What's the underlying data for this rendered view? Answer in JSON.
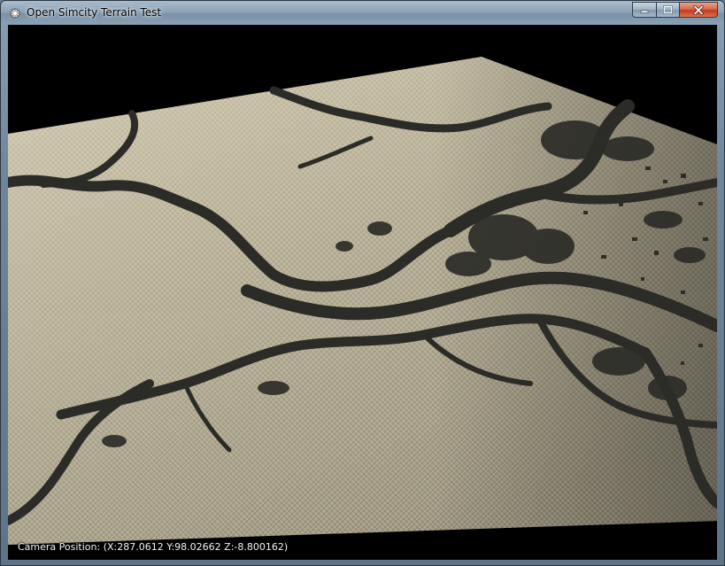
{
  "window": {
    "title": "Open Simcity Terrain Test",
    "app_icon": "gear-sparkle-icon",
    "caption_buttons": {
      "minimize": "minimize-icon",
      "maximize": "maximize-icon",
      "close": "close-icon"
    }
  },
  "viewport": {
    "background": "#000000",
    "terrain_colors": {
      "land": "#a8a089",
      "land_light": "#c4bca4",
      "wireframe": "#e8e2d2",
      "water": "#2c2c28"
    }
  },
  "hud": {
    "camera_position": "Camera Position: (X:287.0612 Y:98.02662 Z:-8.800162)"
  }
}
